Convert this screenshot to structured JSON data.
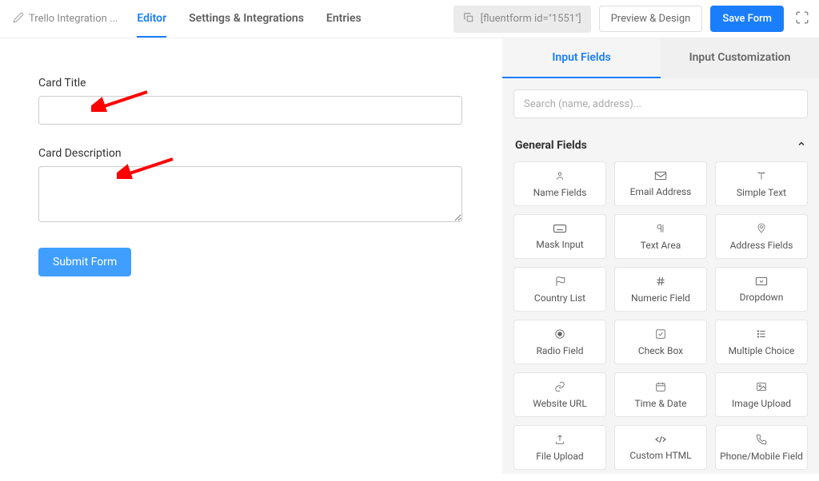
{
  "header": {
    "form_name": "Trello Integration ...",
    "shortcode": "[fluentform id=\"1551\"]",
    "nav": {
      "editor": "Editor",
      "settings": "Settings & Integrations",
      "entries": "Entries"
    },
    "buttons": {
      "preview": "Preview & Design",
      "save": "Save Form"
    }
  },
  "canvas": {
    "card_title_label": "Card Title",
    "card_description_label": "Card Description",
    "submit_label": "Submit Form"
  },
  "sidebar": {
    "tabs": {
      "input_fields": "Input Fields",
      "input_customization": "Input Customization"
    },
    "search_placeholder": "Search (name, address)...",
    "section_title": "General Fields",
    "fields": [
      {
        "label": "Name Fields",
        "icon": "person"
      },
      {
        "label": "Email Address",
        "icon": "mail"
      },
      {
        "label": "Simple Text",
        "icon": "text"
      },
      {
        "label": "Mask Input",
        "icon": "keyboard"
      },
      {
        "label": "Text Area",
        "icon": "paragraph"
      },
      {
        "label": "Address Fields",
        "icon": "pin"
      },
      {
        "label": "Country List",
        "icon": "flag"
      },
      {
        "label": "Numeric Field",
        "icon": "hash"
      },
      {
        "label": "Dropdown",
        "icon": "dropdown"
      },
      {
        "label": "Radio Field",
        "icon": "radio"
      },
      {
        "label": "Check Box",
        "icon": "checkbox"
      },
      {
        "label": "Multiple Choice",
        "icon": "list"
      },
      {
        "label": "Website URL",
        "icon": "link"
      },
      {
        "label": "Time & Date",
        "icon": "calendar"
      },
      {
        "label": "Image Upload",
        "icon": "image"
      },
      {
        "label": "File Upload",
        "icon": "upload"
      },
      {
        "label": "Custom HTML",
        "icon": "code"
      },
      {
        "label": "Phone/Mobile Field",
        "icon": "phone"
      }
    ]
  }
}
